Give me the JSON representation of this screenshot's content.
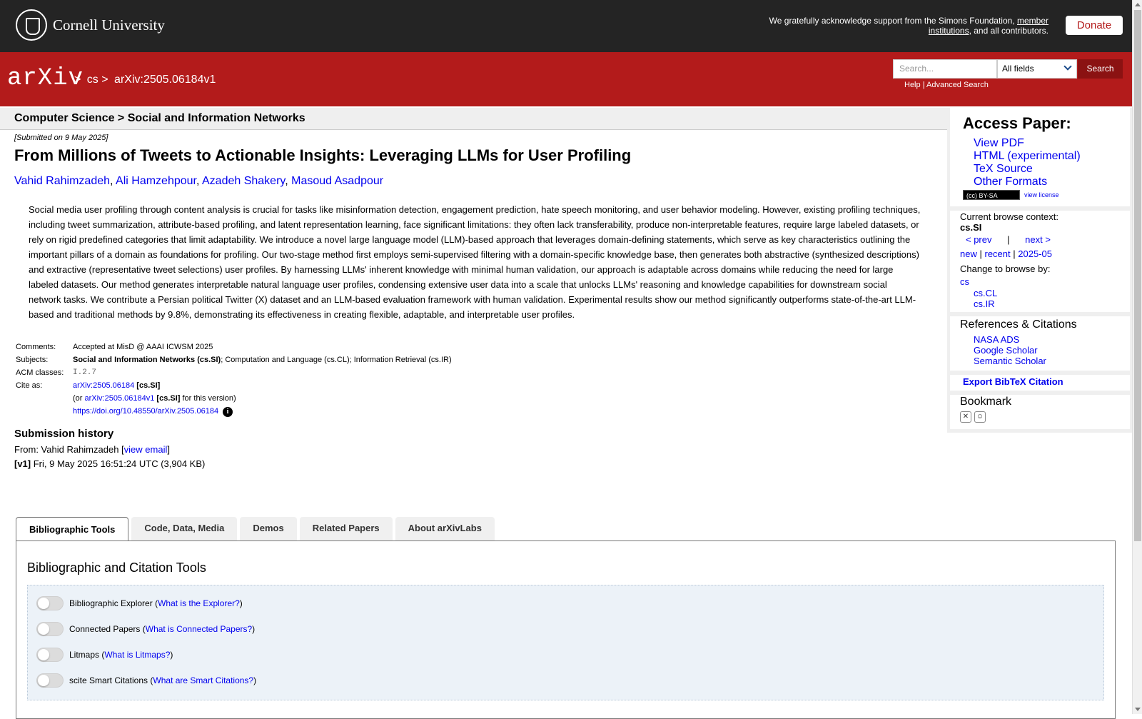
{
  "cornell": {
    "name": "Cornell University",
    "support_text": "We gratefully acknowledge support from the Simons Foundation,",
    "support_link": "member institutions",
    "support_suffix": ", and all contributors.",
    "donate_label": "Donate"
  },
  "header": {
    "logo": "arXiv",
    "breadcrumb": [
      ">",
      "cs",
      ">",
      "arXiv:2505.06184v1"
    ],
    "search_placeholder": "Search...",
    "search_field": "All fields",
    "search_button": "Search",
    "help_link": "Help",
    "separator": "|",
    "advanced_link": "Advanced Search"
  },
  "subheader": {
    "title": "Computer Science > Social and Information Networks"
  },
  "paper": {
    "submitted": "[Submitted on 9 May 2025]",
    "title": "From Millions of Tweets to Actionable Insights: Leveraging LLMs for User Profiling",
    "authors": [
      "Vahid Rahimzadeh",
      "Ali Hamzehpour",
      "Azadeh Shakery",
      "Masoud Asadpour"
    ],
    "abstract": "Social media user profiling through content analysis is crucial for tasks like misinformation detection, engagement prediction, hate speech monitoring, and user behavior modeling. However, existing profiling techniques, including tweet summarization, attribute-based profiling, and latent representation learning, face significant limitations: they often lack transferability, produce non-interpretable features, require large labeled datasets, or rely on rigid predefined categories that limit adaptability. We introduce a novel large language model (LLM)-based approach that leverages domain-defining statements, which serve as key characteristics outlining the important pillars of a domain as foundations for profiling. Our two-stage method first employs semi-supervised filtering with a domain-specific knowledge base, then generates both abstractive (synthesized descriptions) and extractive (representative tweet selections) user profiles. By harnessing LLMs' inherent knowledge with minimal human validation, our approach is adaptable across domains while reducing the need for large labeled datasets. Our method generates interpretable natural language user profiles, condensing extensive user data into a scale that unlocks LLMs' reasoning and knowledge capabilities for downstream social network tasks. We contribute a Persian political Twitter (X) dataset and an LLM-based evaluation framework with human validation. Experimental results show our method significantly outperforms state-of-the-art LLM-based and traditional methods by 9.8%, demonstrating its effectiveness in creating flexible, adaptable, and interpretable user profiles."
  },
  "meta": {
    "comments_label": "Comments:",
    "comments": "Accepted at MisD @ AAAI ICWSM 2025",
    "subjects_label": "Subjects:",
    "subjects_primary": "Social and Information Networks (cs.SI)",
    "subjects_rest": "; Computation and Language (cs.CL); Information Retrieval (cs.IR)",
    "acm_label": "ACM classes:",
    "acm_abbr": "ACM",
    "acm_word": " classes:",
    "acm": "I.2.7",
    "cite_label": "Cite as:",
    "cite_id": "arXiv:2505.06184",
    "cite_cat": "[cs.SI]",
    "cite_or": "(or ",
    "cite_version_id": "arXiv:2505.06184v1",
    "cite_version_cat": "[cs.SI]",
    "cite_version_suffix": " for this version)",
    "doi": "https://doi.org/10.48550/arXiv.2505.06184"
  },
  "history": {
    "title": "Submission history",
    "from_label": "From: Vahid Rahimzadeh [",
    "view_email": "view email",
    "from_close": "]",
    "version": "[v1]",
    "version_text": " Fri, 9 May 2025 16:51:24 UTC (3,904 KB)"
  },
  "sidebar": {
    "access_title": "Access Paper:",
    "access_links": [
      "View PDF",
      "HTML (experimental)",
      "TeX Source",
      "Other Formats"
    ],
    "license_badge": "(cc) BY-SA",
    "view_license": "view license",
    "context_label": "Current browse context:",
    "context": "cs.SI",
    "prev": "< prev",
    "nav_sep": "|",
    "next": "next >",
    "new": "new",
    "recent": "recent",
    "month": "2025-05",
    "change_label": "Change to browse by:",
    "browse_cats": [
      "cs",
      "cs.CL",
      "cs.IR"
    ],
    "refs_title": "References & Citations",
    "refs_links": [
      "NASA ADS",
      "Google Scholar",
      "Semantic Scholar"
    ],
    "bibtex": "Export BibTeX Citation",
    "bookmark_title": "Bookmark"
  },
  "tabs": {
    "items": [
      "Bibliographic Tools",
      "Code, Data, Media",
      "Demos",
      "Related Papers",
      "About arXivLabs"
    ],
    "panel_title": "Bibliographic and Citation Tools",
    "tools": [
      {
        "name": "Bibliographic Explorer",
        "link": "What is the Explorer?"
      },
      {
        "name": "Connected Papers",
        "link": "What is Connected Papers?"
      },
      {
        "name": "Litmaps",
        "link": "What is Litmaps?"
      },
      {
        "name": "scite Smart Citations",
        "link": "What are Smart Citations?"
      }
    ]
  },
  "colors": {
    "arxiv_red": "#b31b1b",
    "link": "#0000ee",
    "dark_bar": "#242424"
  }
}
